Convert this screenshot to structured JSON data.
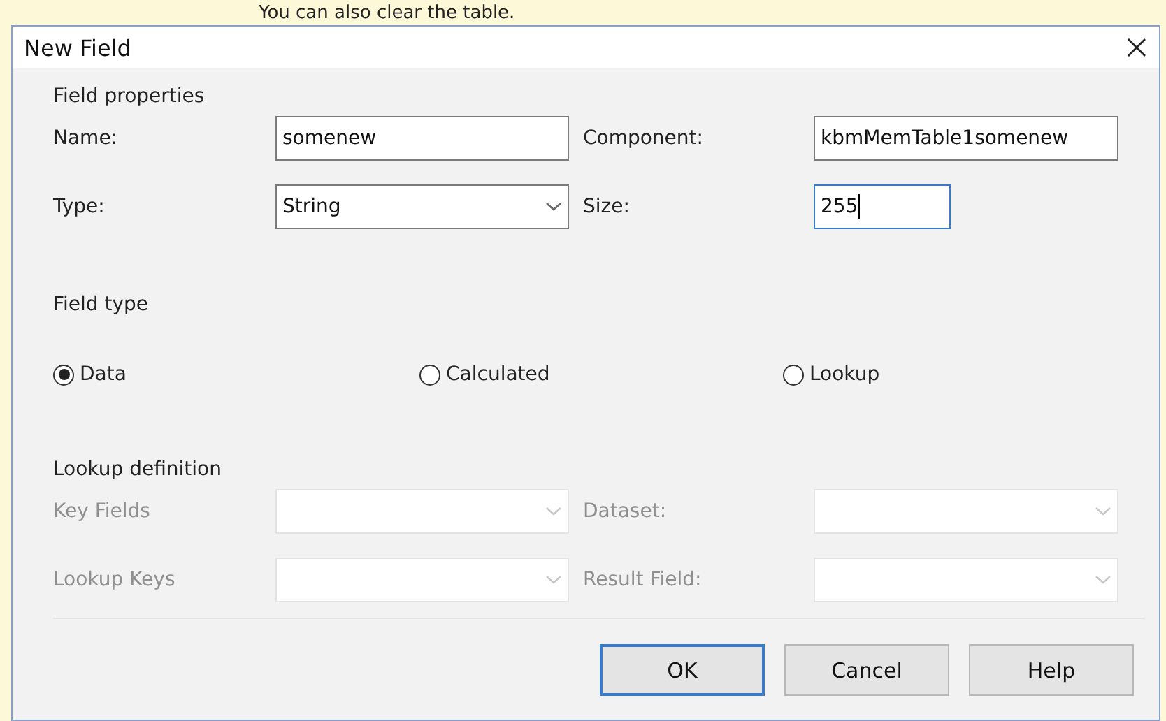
{
  "background_text": "You can also clear the table.",
  "window": {
    "title": "New Field"
  },
  "field_properties": {
    "title": "Field properties",
    "fields": [
      {
        "label": "Name:",
        "kind": "text",
        "value": "somenew",
        "focused": false,
        "disabled": false
      },
      {
        "label": "Component:",
        "kind": "text",
        "value": "kbmMemTable1somenew",
        "focused": false,
        "disabled": false
      },
      {
        "label": "Type:",
        "kind": "dropdown",
        "value": "String",
        "focused": false,
        "disabled": false
      },
      {
        "label": "Size:",
        "kind": "short",
        "value": "255",
        "focused": true,
        "disabled": false
      }
    ]
  },
  "field_type": {
    "title": "Field type",
    "options": [
      {
        "label": "Data",
        "selected": true
      },
      {
        "label": "Calculated",
        "selected": false
      },
      {
        "label": "Lookup",
        "selected": false
      }
    ]
  },
  "lookup_definition": {
    "title": "Lookup definition",
    "fields": [
      {
        "label": "Key Fields",
        "kind": "dropdown",
        "disabled": true
      },
      {
        "label": "Dataset:",
        "kind": "dropdown",
        "disabled": true
      },
      {
        "label": "Lookup Keys",
        "kind": "dropdown",
        "disabled": true
      },
      {
        "label": "Result Field:",
        "kind": "dropdown",
        "disabled": true
      }
    ]
  },
  "buttons": [
    {
      "label": "OK",
      "default": true
    },
    {
      "label": "Cancel",
      "default": false
    },
    {
      "label": "Help",
      "default": false
    }
  ]
}
